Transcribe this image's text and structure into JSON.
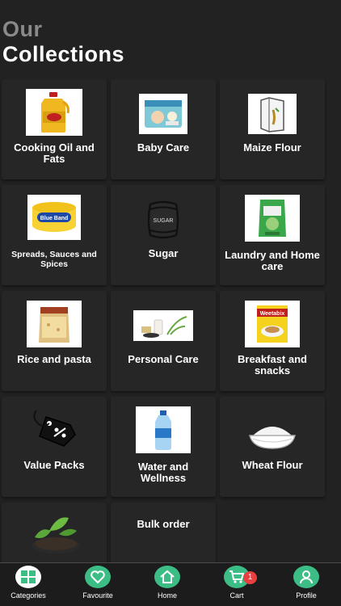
{
  "header": {
    "line1": "Our",
    "line2": "Collections"
  },
  "categories": [
    {
      "label": "Cooking Oil and Fats",
      "icon": "cooking-oil-bottle"
    },
    {
      "label": "Baby Care",
      "icon": "diaper-pack"
    },
    {
      "label": "Maize Flour",
      "icon": "flour-bag"
    },
    {
      "label": "Spreads, Sauces and Spices",
      "icon": "spread-tub"
    },
    {
      "label": "Sugar",
      "icon": "sugar-bag"
    },
    {
      "label": "Laundry and Home care",
      "icon": "detergent-bag"
    },
    {
      "label": "Rice and pasta",
      "icon": "rice-bag"
    },
    {
      "label": "Personal Care",
      "icon": "spa-products"
    },
    {
      "label": "Breakfast and snacks",
      "icon": "cereal-box"
    },
    {
      "label": "Value Packs",
      "icon": "discount-tag"
    },
    {
      "label": "Water and Wellness",
      "icon": "water-bottle"
    },
    {
      "label": "Wheat Flour",
      "icon": "flour-bowl"
    },
    {
      "label": "",
      "icon": "tea-leaves"
    },
    {
      "label": "Bulk order",
      "icon": ""
    }
  ],
  "product_text": {
    "blue_band": "Blue Band",
    "sugar": "SUGAR",
    "weetabix": "Weetabix"
  },
  "nav": {
    "categories": "Categories",
    "favourite": "Favourite",
    "home": "Home",
    "cart": "Cart",
    "cart_count": "1",
    "profile": "Profile"
  },
  "colors": {
    "background": "#222222",
    "accent": "#3dbd86",
    "badge": "#e84040"
  }
}
